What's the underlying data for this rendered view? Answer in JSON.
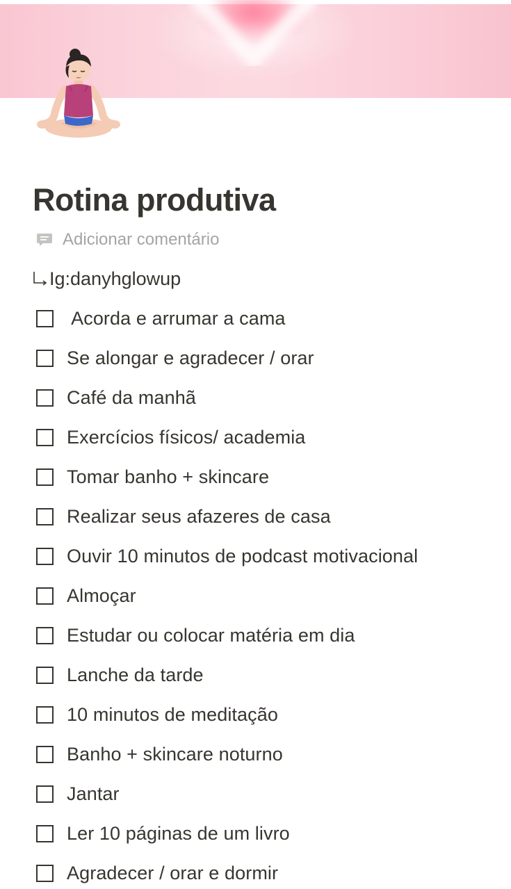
{
  "page": {
    "title": "Rotina produtiva",
    "icon": "meditating-woman-emoji",
    "cover": "pink-gradient-heart-cover"
  },
  "comment": {
    "label": "Adicionar comentário",
    "icon": "comment-icon"
  },
  "handle": {
    "text": "Ig:danyhglowup",
    "icon": "return-arrow-icon"
  },
  "todos": [
    {
      "label": " Acorda e arrumar a cama",
      "checked": false
    },
    {
      "label": "Se alongar e agradecer / orar",
      "checked": false
    },
    {
      "label": "Café da manhã",
      "checked": false
    },
    {
      "label": "Exercícios físicos/ academia",
      "checked": false
    },
    {
      "label": "Tomar banho + skincare",
      "checked": false
    },
    {
      "label": "Realizar seus afazeres de casa",
      "checked": false
    },
    {
      "label": "Ouvir 10 minutos de podcast motivacional",
      "checked": false
    },
    {
      "label": "Almoçar",
      "checked": false
    },
    {
      "label": "Estudar ou colocar matéria em dia",
      "checked": false
    },
    {
      "label": "Lanche da tarde",
      "checked": false
    },
    {
      "label": "10 minutos de meditação",
      "checked": false
    },
    {
      "label": "Banho + skincare noturno",
      "checked": false
    },
    {
      "label": "Jantar",
      "checked": false
    },
    {
      "label": "Ler 10 páginas de um livro",
      "checked": false
    },
    {
      "label": "Agradecer / orar e dormir",
      "checked": false
    }
  ],
  "colors": {
    "text": "#37352f",
    "muted": "#a5a4a1",
    "cover_pink": "#f9c6d2"
  }
}
